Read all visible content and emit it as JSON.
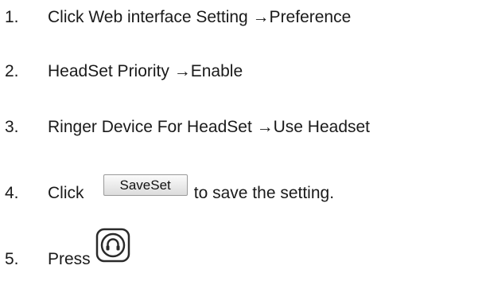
{
  "steps": [
    {
      "number": "1.",
      "text": "Click Web interface Setting →Preference"
    },
    {
      "number": "2.",
      "text": "HeadSet Priority →Enable"
    },
    {
      "number": "3.",
      "text": "Ringer Device For HeadSet →Use Headset"
    },
    {
      "number": "4.",
      "prefix": "Click",
      "button_label": "SaveSet",
      "suffix": "to save the setting."
    },
    {
      "number": "5.",
      "prefix": "Press",
      "icon": "headset-key-icon"
    }
  ]
}
